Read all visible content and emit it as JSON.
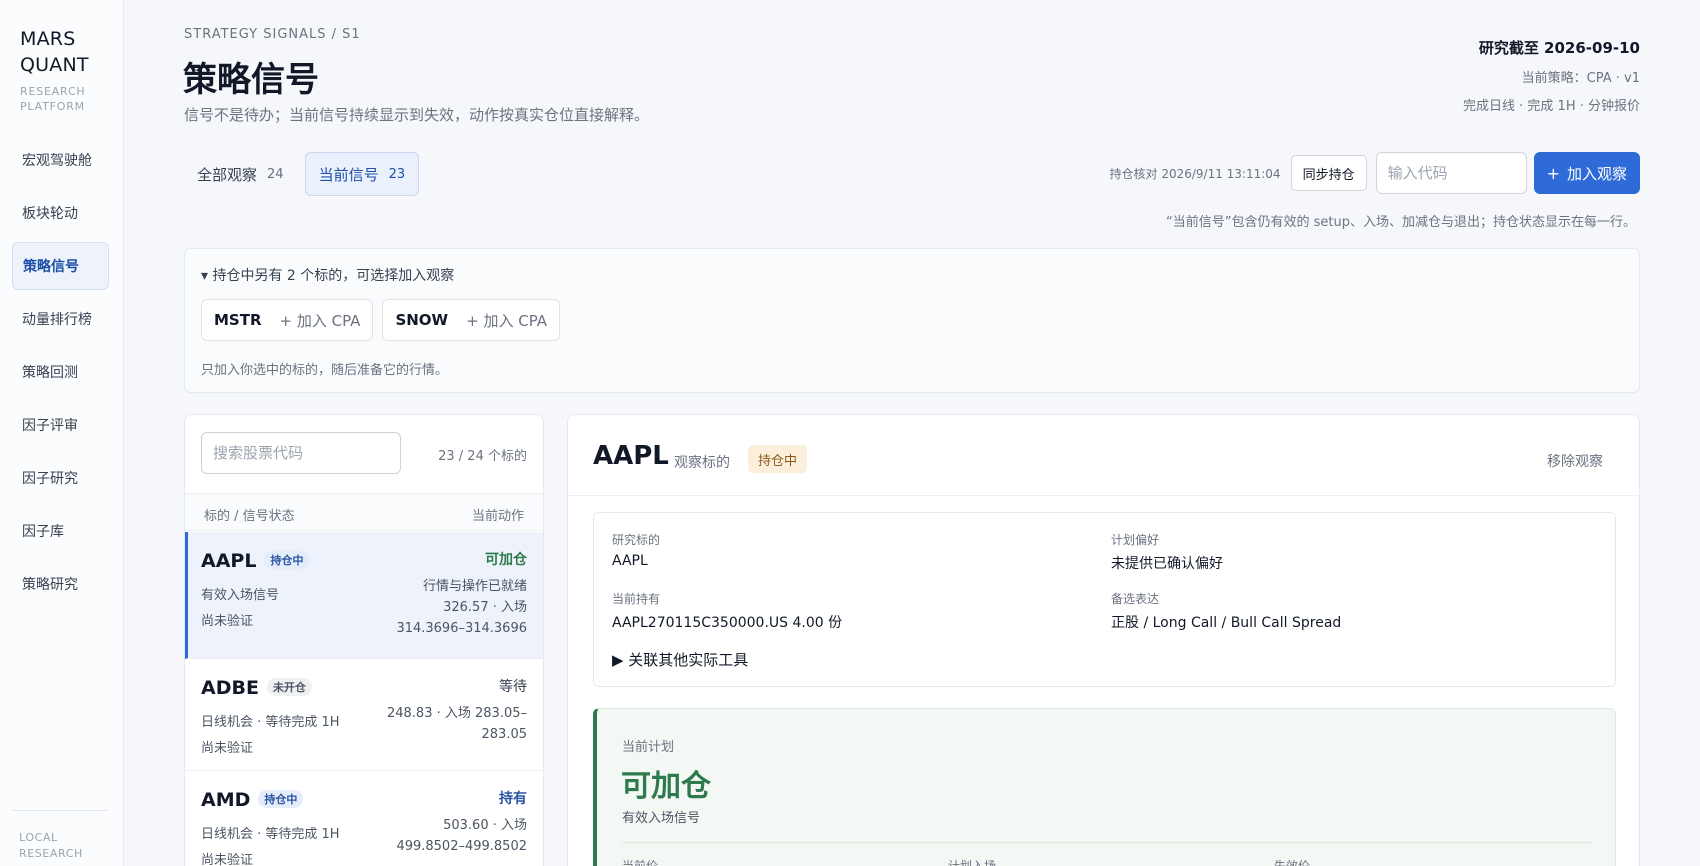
{
  "brand": {
    "name_line1": "MARS",
    "name_line2": "QUANT",
    "sub_line1": "RESEARCH",
    "sub_line2": "PLATFORM"
  },
  "sidebar": {
    "items": [
      {
        "label": "宏观驾驶舱"
      },
      {
        "label": "板块轮动"
      },
      {
        "label": "策略信号"
      },
      {
        "label": "动量排行榜"
      },
      {
        "label": "策略回测"
      },
      {
        "label": "因子评审"
      },
      {
        "label": "因子研究"
      },
      {
        "label": "因子库"
      },
      {
        "label": "策略研究"
      }
    ],
    "footer_line1": "LOCAL",
    "footer_line2": "RESEARCH"
  },
  "header": {
    "breadcrumb": "STRATEGY SIGNALS / S1",
    "title": "策略信号",
    "subtitle": "信号不是待办；当前信号持续显示到失效，动作按真实仓位直接解释。",
    "research_date": "研究截至 2026-09-10",
    "current_strategy": "当前策略：CPA · v1",
    "data_status": "完成日线 · 完成 1H · 分钟报价"
  },
  "tabs": [
    {
      "label": "全部观察",
      "count": "24"
    },
    {
      "label": "当前信号",
      "count": "23"
    }
  ],
  "toolbar": {
    "sync_time": "持仓核对 2026/9/11 13:11:04",
    "sync_label": "同步持仓",
    "code_placeholder": "输入代码",
    "add_label": "加入观察",
    "note": "“当前信号”包含仍有效的 setup、入场、加减仓与退出；持仓状态显示在每一行。"
  },
  "holdings": {
    "toggle": "▾ 持仓中另有 2 个标的，可选择加入观察",
    "chips": [
      {
        "symbol": "MSTR",
        "action": "+ 加入 CPA"
      },
      {
        "symbol": "SNOW",
        "action": "+ 加入 CPA"
      }
    ],
    "note": "只加入你选中的标的，随后准备它的行情。"
  },
  "list": {
    "search_placeholder": "搜索股票代码",
    "count": "23 / 24 个标的",
    "header_left": "标的 / 信号状态",
    "header_right": "当前动作",
    "rows": [
      {
        "symbol": "AAPL",
        "badge": "持仓中",
        "line1": "有效入场信号",
        "line2": "尚未验证",
        "action": "可加仓",
        "detail1": "行情与操作已就绪",
        "detail2": "326.57 · 入场",
        "detail3": "314.3696–314.3696"
      },
      {
        "symbol": "ADBE",
        "badge": "未开仓",
        "line1": "日线机会 · 等待完成 1H",
        "line2": "尚未验证",
        "action": "等待",
        "detail1": "248.83 · 入场 283.05–",
        "detail2": "283.05"
      },
      {
        "symbol": "AMD",
        "badge": "持仓中",
        "line1": "日线机会 · 等待完成 1H",
        "line2": "尚未验证",
        "action": "持有",
        "detail1": "503.60 · 入场",
        "detail2": "499.8502–499.8502"
      }
    ]
  },
  "detail": {
    "symbol": "AAPL",
    "type": "观察标的",
    "badge": "持仓中",
    "remove_label": "移除观察",
    "info": {
      "research_label": "研究标的",
      "research_value": "AAPL",
      "pref_label": "计划偏好",
      "pref_value": "未提供已确认偏好",
      "holding_label": "当前持有",
      "holding_value": "AAPL270115C350000.US 4.00 份",
      "alt_label": "备选表达",
      "alt_value": "正股 / Long Call / Bull Call Spread",
      "toggle": "▶ 关联其他实际工具"
    },
    "plan": {
      "label": "当前计划",
      "action": "可加仓",
      "desc": "有效入场信号",
      "col1": "当前价",
      "col2": "计划入场",
      "col3": "失效价"
    }
  },
  "colors": {
    "accent": "#2f6bd8",
    "positive": "#2f7a4d",
    "holding_badge": "#8a5a16"
  }
}
